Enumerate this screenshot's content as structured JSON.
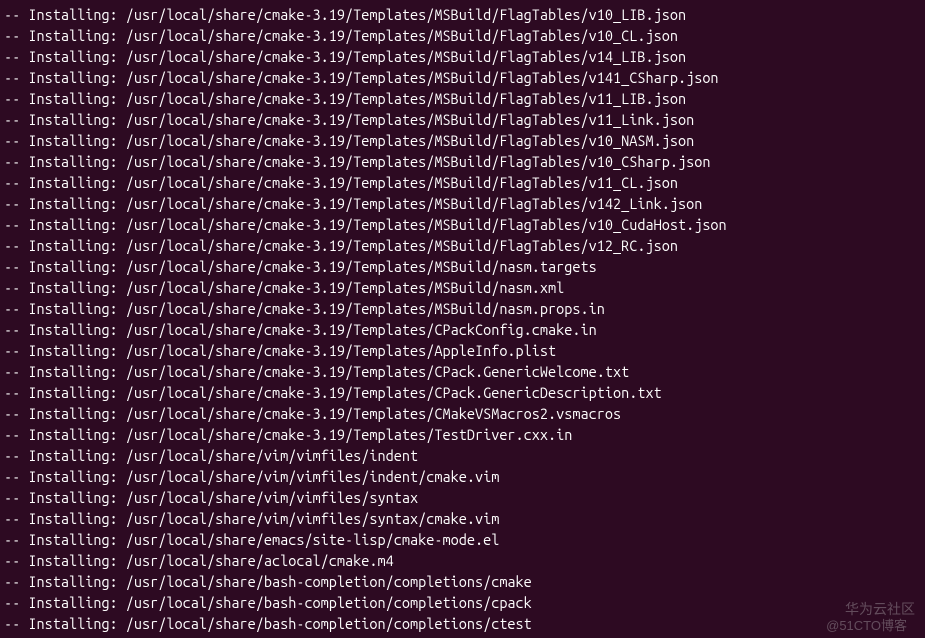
{
  "terminal": {
    "prefix": "-- Installing: ",
    "lines": [
      "/usr/local/share/cmake-3.19/Templates/MSBuild/FlagTables/v10_LIB.json",
      "/usr/local/share/cmake-3.19/Templates/MSBuild/FlagTables/v10_CL.json",
      "/usr/local/share/cmake-3.19/Templates/MSBuild/FlagTables/v14_LIB.json",
      "/usr/local/share/cmake-3.19/Templates/MSBuild/FlagTables/v141_CSharp.json",
      "/usr/local/share/cmake-3.19/Templates/MSBuild/FlagTables/v11_LIB.json",
      "/usr/local/share/cmake-3.19/Templates/MSBuild/FlagTables/v11_Link.json",
      "/usr/local/share/cmake-3.19/Templates/MSBuild/FlagTables/v10_NASM.json",
      "/usr/local/share/cmake-3.19/Templates/MSBuild/FlagTables/v10_CSharp.json",
      "/usr/local/share/cmake-3.19/Templates/MSBuild/FlagTables/v11_CL.json",
      "/usr/local/share/cmake-3.19/Templates/MSBuild/FlagTables/v142_Link.json",
      "/usr/local/share/cmake-3.19/Templates/MSBuild/FlagTables/v10_CudaHost.json",
      "/usr/local/share/cmake-3.19/Templates/MSBuild/FlagTables/v12_RC.json",
      "/usr/local/share/cmake-3.19/Templates/MSBuild/nasm.targets",
      "/usr/local/share/cmake-3.19/Templates/MSBuild/nasm.xml",
      "/usr/local/share/cmake-3.19/Templates/MSBuild/nasm.props.in",
      "/usr/local/share/cmake-3.19/Templates/CPackConfig.cmake.in",
      "/usr/local/share/cmake-3.19/Templates/AppleInfo.plist",
      "/usr/local/share/cmake-3.19/Templates/CPack.GenericWelcome.txt",
      "/usr/local/share/cmake-3.19/Templates/CPack.GenericDescription.txt",
      "/usr/local/share/cmake-3.19/Templates/CMakeVSMacros2.vsmacros",
      "/usr/local/share/cmake-3.19/Templates/TestDriver.cxx.in",
      "/usr/local/share/vim/vimfiles/indent",
      "/usr/local/share/vim/vimfiles/indent/cmake.vim",
      "/usr/local/share/vim/vimfiles/syntax",
      "/usr/local/share/vim/vimfiles/syntax/cmake.vim",
      "/usr/local/share/emacs/site-lisp/cmake-mode.el",
      "/usr/local/share/aclocal/cmake.m4",
      "/usr/local/share/bash-completion/completions/cmake",
      "/usr/local/share/bash-completion/completions/cpack",
      "/usr/local/share/bash-completion/completions/ctest"
    ]
  },
  "watermark": {
    "line1": "华为云社区",
    "line2": "@51CTO博客"
  }
}
